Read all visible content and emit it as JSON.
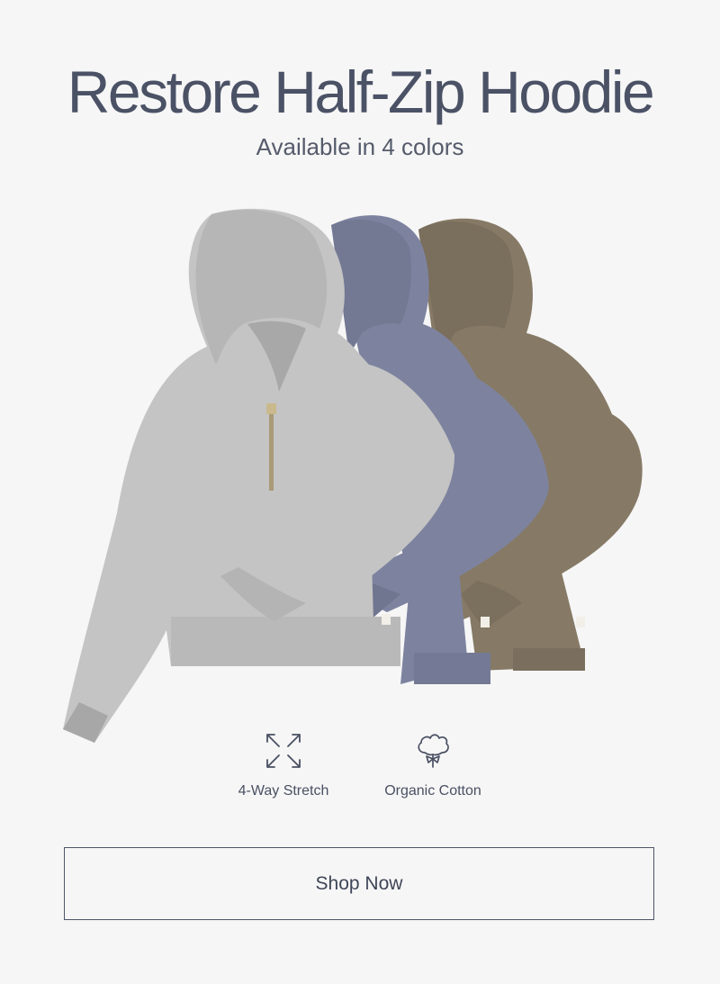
{
  "header": {
    "title": "Restore Half-Zip Hoodie",
    "subtitle": "Available in 4 colors"
  },
  "colors": {
    "heather_grey": "#c4c4c4",
    "slate_blue": "#7e84a3",
    "olive": "#877a66",
    "text": "#4b5266",
    "background": "#f6f6f6"
  },
  "features": [
    {
      "icon": "stretch-arrows-icon",
      "label": "4-Way Stretch"
    },
    {
      "icon": "cotton-flower-icon",
      "label": "Organic Cotton"
    }
  ],
  "cta": {
    "label": "Shop Now"
  }
}
